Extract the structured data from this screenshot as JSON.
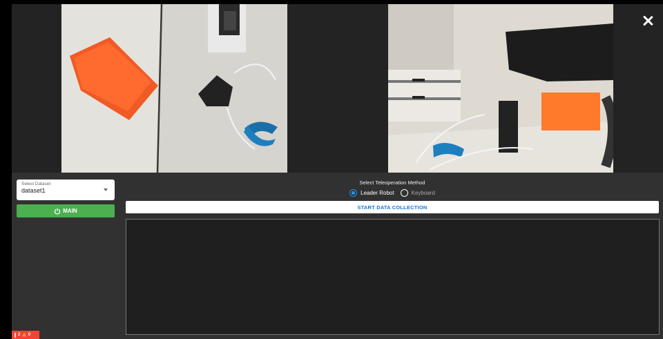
{
  "colors": {
    "app_background": "#232323",
    "controls_background": "#313131",
    "main_button": "#4caf50",
    "accent": "#2196f3",
    "start_text": "#1976d2",
    "error_badge": "#f44336"
  },
  "cameras": {
    "left": {
      "icon": "camera-feed"
    },
    "right": {
      "icon": "camera-feed"
    }
  },
  "window": {
    "close_icon": "close-icon"
  },
  "dataset": {
    "label": "Select Dataset",
    "value": "dataset1"
  },
  "main_button": {
    "label": "MAIN",
    "icon": "power-icon"
  },
  "teleoperation": {
    "title": "Select Teleoperation Method",
    "options": [
      {
        "label": "Leader Robot",
        "selected": true
      },
      {
        "label": "Keyboard",
        "selected": false
      }
    ]
  },
  "start_button": {
    "label": "START DATA COLLECTION"
  },
  "status_badge": {
    "errors": "2",
    "warnings": "0"
  }
}
